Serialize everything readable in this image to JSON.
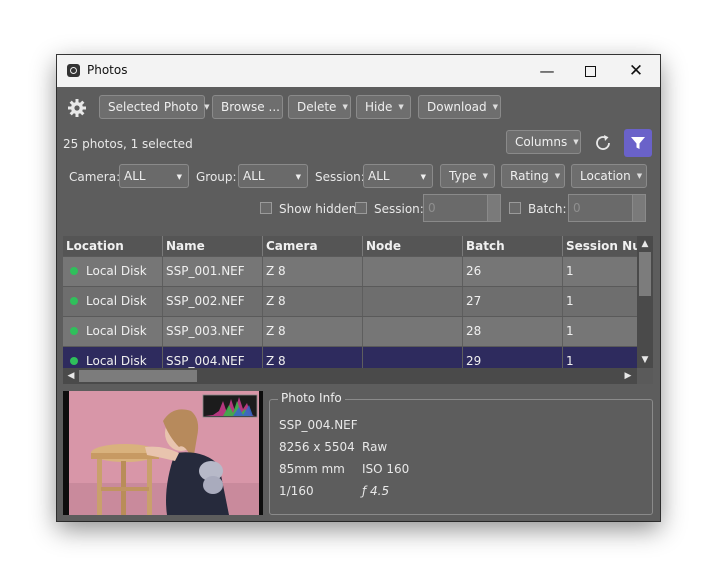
{
  "window": {
    "title": "Photos"
  },
  "toolbar": {
    "selected_photo": "Selected Photo",
    "browse": "Browse ...",
    "delete": "Delete",
    "hide": "Hide",
    "download": "Download",
    "columns": "Columns"
  },
  "status": {
    "summary": "25 photos, 1 selected"
  },
  "filters": {
    "camera_label": "Camera:",
    "camera_value": "ALL",
    "group_label": "Group:",
    "group_value": "ALL",
    "session_label": "Session:",
    "session_value": "ALL",
    "type": "Type",
    "rating": "Rating",
    "location": "Location",
    "show_hidden": "Show hidden",
    "session_check": "Session:",
    "session_spin": "0",
    "batch_check": "Batch:",
    "batch_spin": "0"
  },
  "table": {
    "columns": [
      "Location",
      "Name",
      "Camera",
      "Node",
      "Batch",
      "Session Num"
    ],
    "rows": [
      {
        "location": "Local Disk",
        "name": "SSP_001.NEF",
        "camera": "Z 8",
        "node": "",
        "batch": "26",
        "session": "1"
      },
      {
        "location": "Local Disk",
        "name": "SSP_002.NEF",
        "camera": "Z 8",
        "node": "",
        "batch": "27",
        "session": "1"
      },
      {
        "location": "Local Disk",
        "name": "SSP_003.NEF",
        "camera": "Z 8",
        "node": "",
        "batch": "28",
        "session": "1"
      },
      {
        "location": "Local Disk",
        "name": "SSP_004.NEF",
        "camera": "Z 8",
        "node": "",
        "batch": "29",
        "session": "1"
      }
    ],
    "selected_index": 3
  },
  "info": {
    "title": "Photo Info",
    "filename": "SSP_004.NEF",
    "dimensions": "8256 x 5504",
    "format": "Raw",
    "focal": "85mm mm",
    "iso": "ISO 160",
    "shutter": "1/160",
    "aperture": "ƒ 4.5"
  },
  "colors": {
    "accent": "#6a62c9",
    "selected_row": "#2e2b5e",
    "status_dot": "#2fbf5b"
  }
}
